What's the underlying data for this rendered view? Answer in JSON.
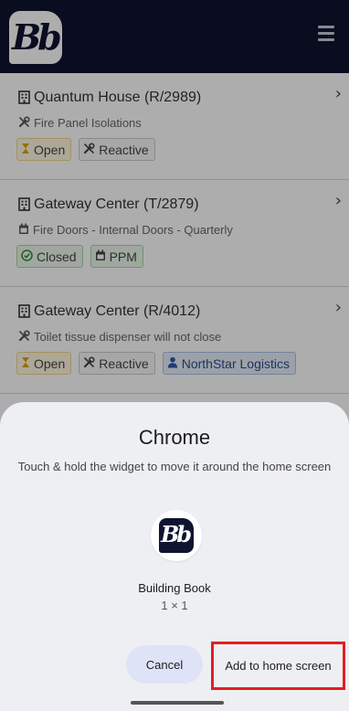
{
  "app": {
    "logo_text": "Bb"
  },
  "jobs": [
    {
      "title": "Quantum House (R/2989)",
      "subtitle": "Fire Panel Isolations",
      "subtitle_icon": "wrench-icon",
      "badges": [
        {
          "label": "Open",
          "icon": "hourglass-icon",
          "kind": "open"
        },
        {
          "label": "Reactive",
          "icon": "wrench-icon",
          "kind": "plain"
        }
      ]
    },
    {
      "title": "Gateway Center (T/2879)",
      "subtitle": "Fire Doors - Internal Doors - Quarterly",
      "subtitle_icon": "calendar-icon",
      "badges": [
        {
          "label": "Closed",
          "icon": "check-circle-icon",
          "kind": "closed"
        },
        {
          "label": "PPM",
          "icon": "calendar-icon",
          "kind": "ppm"
        }
      ]
    },
    {
      "title": "Gateway Center (R/4012)",
      "subtitle": "Toilet tissue dispenser will not close",
      "subtitle_icon": "wrench-icon",
      "badges": [
        {
          "label": "Open",
          "icon": "hourglass-icon",
          "kind": "open"
        },
        {
          "label": "Reactive",
          "icon": "wrench-icon",
          "kind": "plain"
        },
        {
          "label": "NorthStar Logistics",
          "icon": "user-icon",
          "kind": "supplier"
        }
      ]
    }
  ],
  "sheet": {
    "title": "Chrome",
    "description": "Touch & hold the widget to move it around the home screen",
    "widget_name": "Building Book",
    "widget_size": "1 × 1",
    "widget_logo_text": "Bb",
    "cancel_label": "Cancel",
    "add_label": "Add to home screen"
  },
  "colors": {
    "header_bg": "#0f1430",
    "highlight_border": "#e31e24",
    "cancel_bg": "#dfe3f7",
    "sheet_bg": "#eeeff3"
  }
}
